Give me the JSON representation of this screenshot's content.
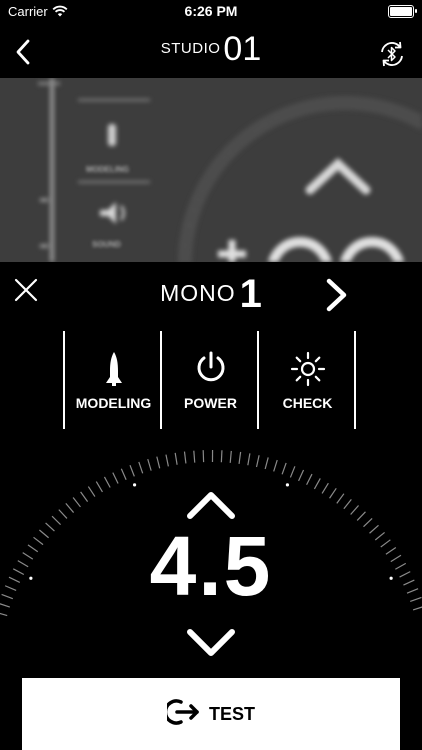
{
  "status_bar": {
    "carrier": "Carrier",
    "time": "6:26 PM"
  },
  "nav": {
    "title_prefix": "STUDIO",
    "title_number": "01"
  },
  "background_studio": {
    "labels": [
      "MODELING",
      "SOUND"
    ]
  },
  "panel": {
    "light_name": "MONO",
    "light_number": "1",
    "modes": [
      {
        "label": "MODELING",
        "icon": "modeling-lamp-icon"
      },
      {
        "label": "POWER",
        "icon": "power-icon"
      },
      {
        "label": "CHECK",
        "icon": "sun-icon"
      }
    ],
    "power_value": "4.5",
    "test_label": "TEST",
    "test_icon": "exit-arrow-icon"
  },
  "colors": {
    "background": "#000000",
    "foreground": "#ffffff",
    "blur_bg": "#3d3d3d"
  }
}
